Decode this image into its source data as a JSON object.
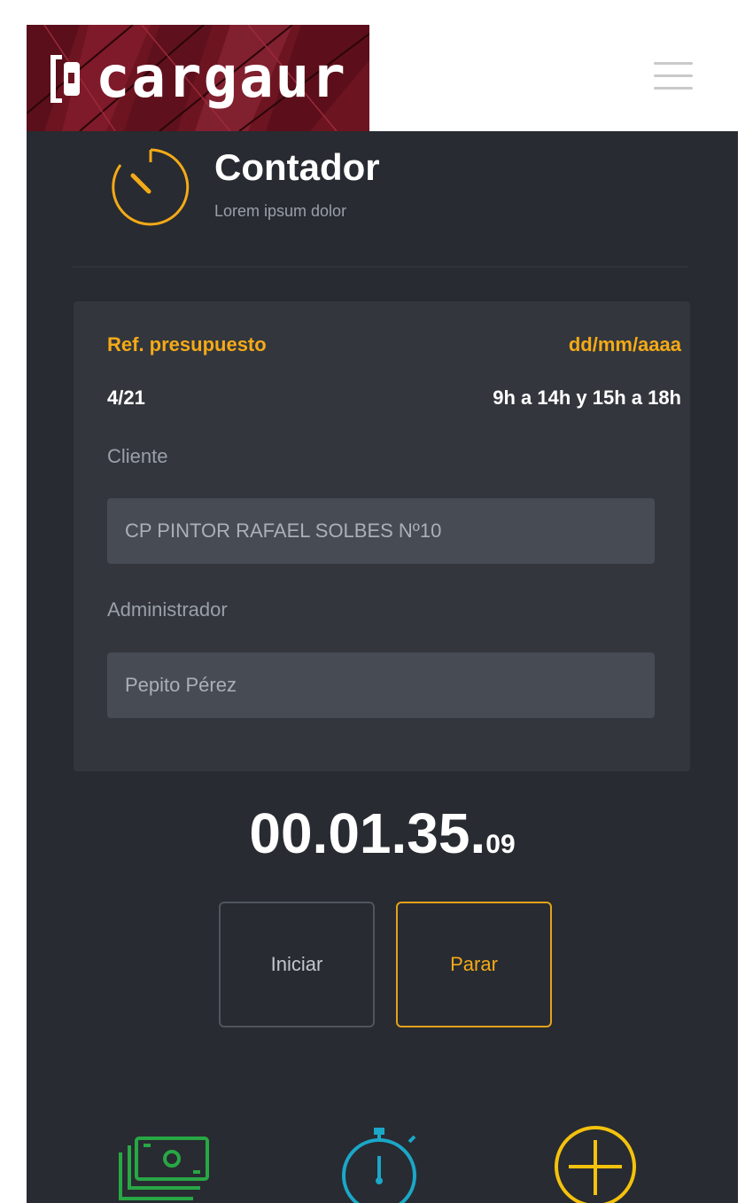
{
  "header": {
    "logo_text": "cargaur",
    "menu_icon": "hamburger-menu-icon",
    "brand_color": "#6d1421"
  },
  "page": {
    "title": "Contador",
    "subtitle": "Lorem ipsum dolor",
    "icon": "stopwatch-icon",
    "accent_color": "#f4aa17"
  },
  "card": {
    "ref_label": "Ref. presupuesto",
    "date_label": "dd/mm/aaaa",
    "ref_value": "4/21",
    "hours_value": "9h a 14h y 15h a 18h",
    "cliente_label": "Cliente",
    "cliente_value": "CP PINTOR RAFAEL SOLBES Nº10",
    "admin_label": "Administrador",
    "admin_value": "Pepito Pérez"
  },
  "timer": {
    "main": "00.01.35.",
    "fraction": "09"
  },
  "controls": {
    "start_label": "Iniciar",
    "stop_label": "Parar"
  },
  "bottom_nav": [
    {
      "icon": "money-icon",
      "color": "#28a745"
    },
    {
      "icon": "stopwatch-icon",
      "color": "#1ba7c8"
    },
    {
      "icon": "add-circle-icon",
      "color": "#f4c20d"
    }
  ]
}
